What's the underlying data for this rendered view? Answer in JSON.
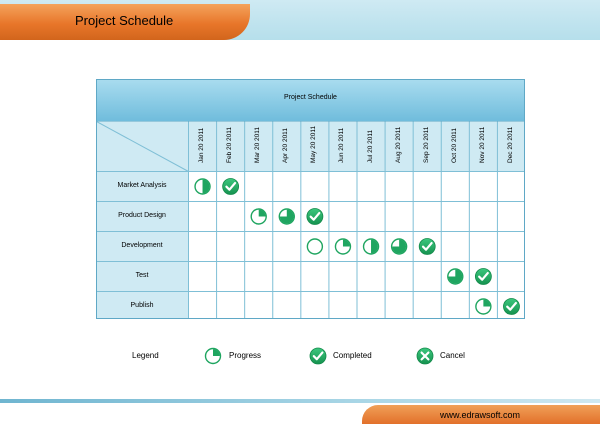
{
  "header": {
    "title": "Project Schedule"
  },
  "table": {
    "title": "Project Schedule",
    "months": [
      "Jan 20 2011",
      "Feb 20 2011",
      "Mar 20 2011",
      "Apr 20 2011",
      "May 20 2011",
      "Jun 20 2011",
      "Jul 20 2011",
      "Aug 20 2011",
      "Sep 20 2011",
      "Oct 20 2011",
      "Nov 20 2011",
      "Dec 20 2011"
    ],
    "tasks": [
      {
        "name": "Market Analysis",
        "marks": [
          {
            "month": 0,
            "status": "progress",
            "fraction": 0.5
          },
          {
            "month": 1,
            "status": "completed"
          }
        ]
      },
      {
        "name": "Product Design",
        "marks": [
          {
            "month": 2,
            "status": "progress",
            "fraction": 0.25
          },
          {
            "month": 3,
            "status": "progress",
            "fraction": 0.75
          },
          {
            "month": 4,
            "status": "completed"
          }
        ]
      },
      {
        "name": "Development",
        "marks": [
          {
            "month": 4,
            "status": "progress",
            "fraction": 0.0
          },
          {
            "month": 5,
            "status": "progress",
            "fraction": 0.25
          },
          {
            "month": 6,
            "status": "progress",
            "fraction": 0.5
          },
          {
            "month": 7,
            "status": "progress",
            "fraction": 0.75
          },
          {
            "month": 8,
            "status": "completed"
          }
        ]
      },
      {
        "name": "Test",
        "marks": [
          {
            "month": 9,
            "status": "progress",
            "fraction": 0.75
          },
          {
            "month": 10,
            "status": "completed"
          }
        ]
      },
      {
        "name": "Publish",
        "marks": [
          {
            "month": 10,
            "status": "progress",
            "fraction": 0.25
          },
          {
            "month": 11,
            "status": "completed"
          }
        ]
      }
    ]
  },
  "legend": {
    "title": "Legend",
    "progress": "Progress",
    "completed": "Completed",
    "cancel": "Cancel"
  },
  "footer": {
    "url": "www.edrawsoft.com"
  },
  "colors": {
    "accent_green": "#1fa560",
    "header_blue": "#8ccfe6",
    "cell_blue": "#cfeaf3",
    "orange": "#e8762a"
  }
}
